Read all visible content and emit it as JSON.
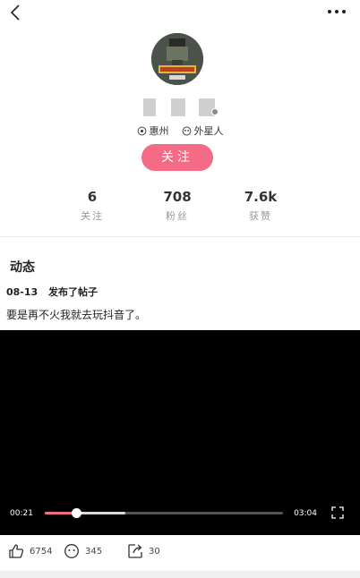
{
  "profile": {
    "location": "惠州",
    "constellation": "外星人",
    "follow_label": "关注"
  },
  "stats": [
    {
      "value": "6",
      "label": "关注"
    },
    {
      "value": "708",
      "label": "粉丝"
    },
    {
      "value": "7.6k",
      "label": "获赞"
    }
  ],
  "feed": {
    "section_title": "动态",
    "post": {
      "date": "08-13",
      "action": "发布了帖子",
      "text": "要是再不火我就去玩抖音了。"
    }
  },
  "video": {
    "current_time": "00:21",
    "total_time": "03:04",
    "progress": 0.13,
    "buffered": 0.34
  },
  "actions": {
    "likes": "6754",
    "comments": "345",
    "shares": "30"
  },
  "colors": {
    "accent": "#f56a84",
    "video_bg": "#000000"
  },
  "icons": [
    "back-icon",
    "more-icon",
    "location-icon",
    "alien-icon",
    "fullscreen-icon",
    "like-icon",
    "comment-icon",
    "share-icon"
  ]
}
